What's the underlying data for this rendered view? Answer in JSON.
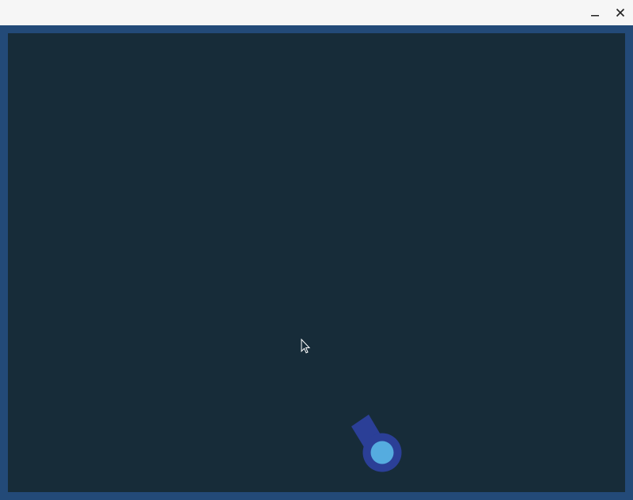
{
  "window": {
    "minimize_icon": "minimize-icon",
    "close_icon": "close-icon",
    "minimize_glyph": "–",
    "close_glyph": "✕"
  },
  "game": {
    "colors": {
      "frame": "#234a78",
      "field": "#172c39",
      "tank_body": "#2b3f97",
      "tank_core": "#55acdf"
    },
    "player": {
      "icon": "tank-icon"
    }
  }
}
